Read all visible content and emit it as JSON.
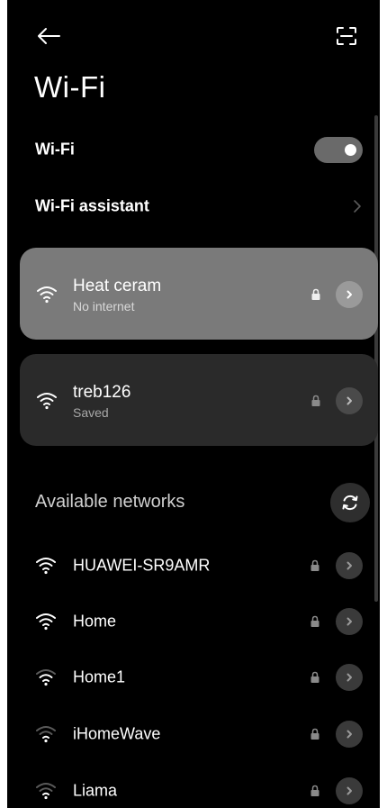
{
  "header": {
    "back_icon": "arrow-left-icon",
    "scan_icon": "scan-frame-icon",
    "title": "Wi-Fi"
  },
  "settings": {
    "wifi_label": "Wi-Fi",
    "wifi_enabled": true,
    "assistant_label": "Wi-Fi assistant"
  },
  "saved_networks": [
    {
      "name": "Heat ceram",
      "status": "No internet",
      "secured": true,
      "state": "connected",
      "signal_bars": 4
    },
    {
      "name": "treb126",
      "status": "Saved",
      "secured": true,
      "state": "saved",
      "signal_bars": 4
    }
  ],
  "available": {
    "header": "Available networks",
    "refresh_icon": "refresh-icon",
    "networks": [
      {
        "name": "HUAWEI-SR9AMR",
        "secured": true,
        "signal_bars": 4
      },
      {
        "name": "Home",
        "secured": true,
        "signal_bars": 4
      },
      {
        "name": "Home1",
        "secured": true,
        "signal_bars": 3
      },
      {
        "name": "iHomeWave",
        "secured": true,
        "signal_bars": 2
      },
      {
        "name": "Liama",
        "secured": true,
        "signal_bars": 2
      }
    ]
  },
  "colors": {
    "background": "#000000",
    "connected_card": "#7a7a7a",
    "saved_card": "#2a2a2a",
    "toggle_on": "#6a6a6a",
    "text_primary": "#ffffff",
    "text_secondary": "#a8a8a8"
  }
}
